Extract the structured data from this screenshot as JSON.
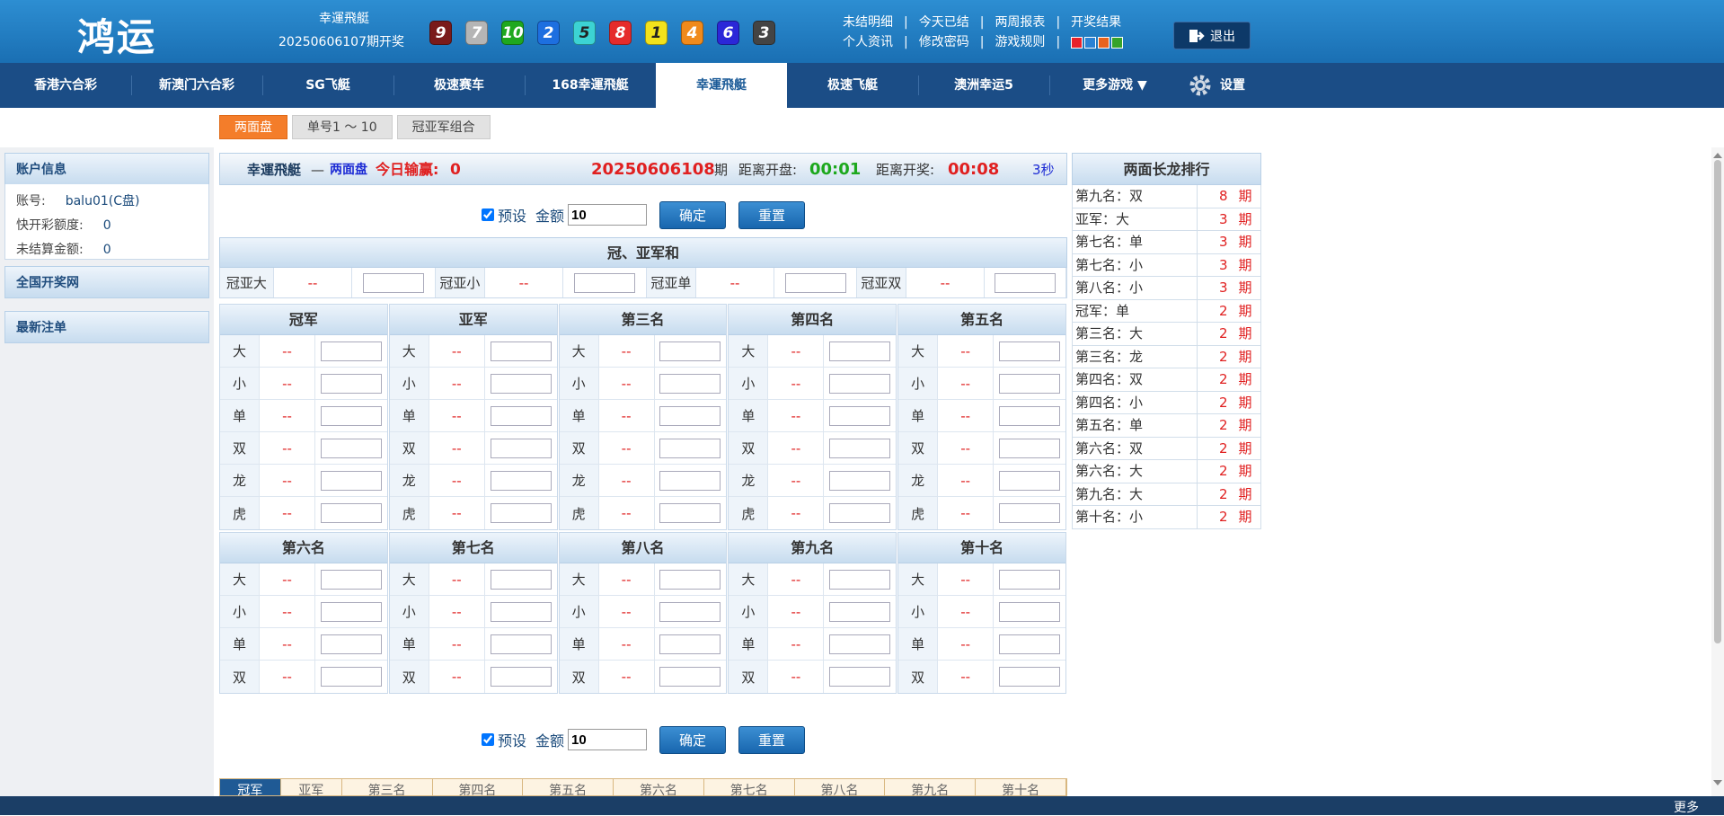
{
  "header": {
    "logo": "鸿运",
    "lottery_name": "幸運飛艇",
    "last_issue": "20250606107期开奖",
    "balls": [
      {
        "num": "9",
        "color": "#7a1a1a"
      },
      {
        "num": "7",
        "color": "#b5b5b5"
      },
      {
        "num": "10",
        "color": "#1fa81f"
      },
      {
        "num": "2",
        "color": "#1d6fe0"
      },
      {
        "num": "5",
        "color": "#3cd3d3"
      },
      {
        "num": "8",
        "color": "#e52b2b"
      },
      {
        "num": "1",
        "color": "#f2e21c"
      },
      {
        "num": "4",
        "color": "#f08a1c"
      },
      {
        "num": "6",
        "color": "#2b27d8"
      },
      {
        "num": "3",
        "color": "#444444"
      }
    ],
    "links_row1": [
      "未结明细",
      "今天已结",
      "两周报表",
      "开奖结果"
    ],
    "links_row2": [
      "个人资讯",
      "修改密码",
      "游戏规则"
    ],
    "swatches": [
      "#e8222b",
      "#2a82d4",
      "#e8631c",
      "#36a32a"
    ],
    "logout": "退出"
  },
  "nav": {
    "items": [
      "香港六合彩",
      "新澳门六合彩",
      "SG飞艇",
      "极速赛车",
      "168幸運飛艇",
      "幸運飛艇",
      "极速飞艇",
      "澳洲幸运5",
      "更多游戏 ▼"
    ],
    "active_index": 5,
    "settings": "设置"
  },
  "subtabs": [
    "两面盘",
    "单号1 ～ 10",
    "冠亚军组合"
  ],
  "sidebar": {
    "account_header": "账户信息",
    "account_rows": [
      {
        "label": "账号:",
        "value": "balu01(C盘)"
      },
      {
        "label": "快开彩额度:",
        "value": "0"
      },
      {
        "label": "未结算金额:",
        "value": "0"
      }
    ],
    "national_header": "全国开奖网",
    "latest_header": "最新注单"
  },
  "titlebar": {
    "game": "幸運飛艇",
    "dash": "—",
    "mode": "两面盘",
    "today_label": "今日输赢:",
    "today_value": "0",
    "issue": "20250606108",
    "issue_suffix": "期",
    "open_label": "距离开盘:",
    "open_value": "00:01",
    "draw_label": "距离开奖:",
    "draw_value": "00:08",
    "refresh": "3秒"
  },
  "controls": {
    "preset_label": "预设",
    "amount_label": "金额",
    "amount_value": "10",
    "confirm": "确定",
    "reset": "重置"
  },
  "combo": {
    "title": "冠、亚军和",
    "items": [
      {
        "label": "冠亚大",
        "odds": "--"
      },
      {
        "label": "冠亚小",
        "odds": "--"
      },
      {
        "label": "冠亚单",
        "odds": "--"
      },
      {
        "label": "冠亚双",
        "odds": "--"
      }
    ]
  },
  "positions_top": [
    {
      "title": "冠军",
      "rows": [
        {
          "l": "大",
          "o": "--"
        },
        {
          "l": "小",
          "o": "--"
        },
        {
          "l": "单",
          "o": "--"
        },
        {
          "l": "双",
          "o": "--"
        },
        {
          "l": "龙",
          "o": "--"
        },
        {
          "l": "虎",
          "o": "--"
        }
      ]
    },
    {
      "title": "亚军",
      "rows": [
        {
          "l": "大",
          "o": "--"
        },
        {
          "l": "小",
          "o": "--"
        },
        {
          "l": "单",
          "o": "--"
        },
        {
          "l": "双",
          "o": "--"
        },
        {
          "l": "龙",
          "o": "--"
        },
        {
          "l": "虎",
          "o": "--"
        }
      ]
    },
    {
      "title": "第三名",
      "rows": [
        {
          "l": "大",
          "o": "--"
        },
        {
          "l": "小",
          "o": "--"
        },
        {
          "l": "单",
          "o": "--"
        },
        {
          "l": "双",
          "o": "--"
        },
        {
          "l": "龙",
          "o": "--"
        },
        {
          "l": "虎",
          "o": "--"
        }
      ]
    },
    {
      "title": "第四名",
      "rows": [
        {
          "l": "大",
          "o": "--"
        },
        {
          "l": "小",
          "o": "--"
        },
        {
          "l": "单",
          "o": "--"
        },
        {
          "l": "双",
          "o": "--"
        },
        {
          "l": "龙",
          "o": "--"
        },
        {
          "l": "虎",
          "o": "--"
        }
      ]
    },
    {
      "title": "第五名",
      "rows": [
        {
          "l": "大",
          "o": "--"
        },
        {
          "l": "小",
          "o": "--"
        },
        {
          "l": "单",
          "o": "--"
        },
        {
          "l": "双",
          "o": "--"
        },
        {
          "l": "龙",
          "o": "--"
        },
        {
          "l": "虎",
          "o": "--"
        }
      ]
    }
  ],
  "positions_bottom": [
    {
      "title": "第六名",
      "rows": [
        {
          "l": "大",
          "o": "--"
        },
        {
          "l": "小",
          "o": "--"
        },
        {
          "l": "单",
          "o": "--"
        },
        {
          "l": "双",
          "o": "--"
        }
      ]
    },
    {
      "title": "第七名",
      "rows": [
        {
          "l": "大",
          "o": "--"
        },
        {
          "l": "小",
          "o": "--"
        },
        {
          "l": "单",
          "o": "--"
        },
        {
          "l": "双",
          "o": "--"
        }
      ]
    },
    {
      "title": "第八名",
      "rows": [
        {
          "l": "大",
          "o": "--"
        },
        {
          "l": "小",
          "o": "--"
        },
        {
          "l": "单",
          "o": "--"
        },
        {
          "l": "双",
          "o": "--"
        }
      ]
    },
    {
      "title": "第九名",
      "rows": [
        {
          "l": "大",
          "o": "--"
        },
        {
          "l": "小",
          "o": "--"
        },
        {
          "l": "单",
          "o": "--"
        },
        {
          "l": "双",
          "o": "--"
        }
      ]
    },
    {
      "title": "第十名",
      "rows": [
        {
          "l": "大",
          "o": "--"
        },
        {
          "l": "小",
          "o": "--"
        },
        {
          "l": "单",
          "o": "--"
        },
        {
          "l": "双",
          "o": "--"
        }
      ]
    }
  ],
  "ranking": {
    "title": "两面长龙排行",
    "rows": [
      {
        "name": "第九名：双",
        "count": "8",
        "unit": "期"
      },
      {
        "name": "亚军：大",
        "count": "3",
        "unit": "期"
      },
      {
        "name": "第七名：单",
        "count": "3",
        "unit": "期"
      },
      {
        "name": "第七名：小",
        "count": "3",
        "unit": "期"
      },
      {
        "name": "第八名：小",
        "count": "3",
        "unit": "期"
      },
      {
        "name": "冠军：单",
        "count": "2",
        "unit": "期"
      },
      {
        "name": "第三名：大",
        "count": "2",
        "unit": "期"
      },
      {
        "name": "第三名：龙",
        "count": "2",
        "unit": "期"
      },
      {
        "name": "第四名：双",
        "count": "2",
        "unit": "期"
      },
      {
        "name": "第四名：小",
        "count": "2",
        "unit": "期"
      },
      {
        "name": "第五名：单",
        "count": "2",
        "unit": "期"
      },
      {
        "name": "第六名：双",
        "count": "2",
        "unit": "期"
      },
      {
        "name": "第六名：大",
        "count": "2",
        "unit": "期"
      },
      {
        "name": "第九名：大",
        "count": "2",
        "unit": "期"
      },
      {
        "name": "第十名：小",
        "count": "2",
        "unit": "期"
      }
    ]
  },
  "bottom_tabs": [
    "冠军",
    "亚军",
    "第三名",
    "第四名",
    "第五名",
    "第六名",
    "第七名",
    "第八名",
    "第九名",
    "第十名"
  ],
  "footer": {
    "more": "更多"
  }
}
